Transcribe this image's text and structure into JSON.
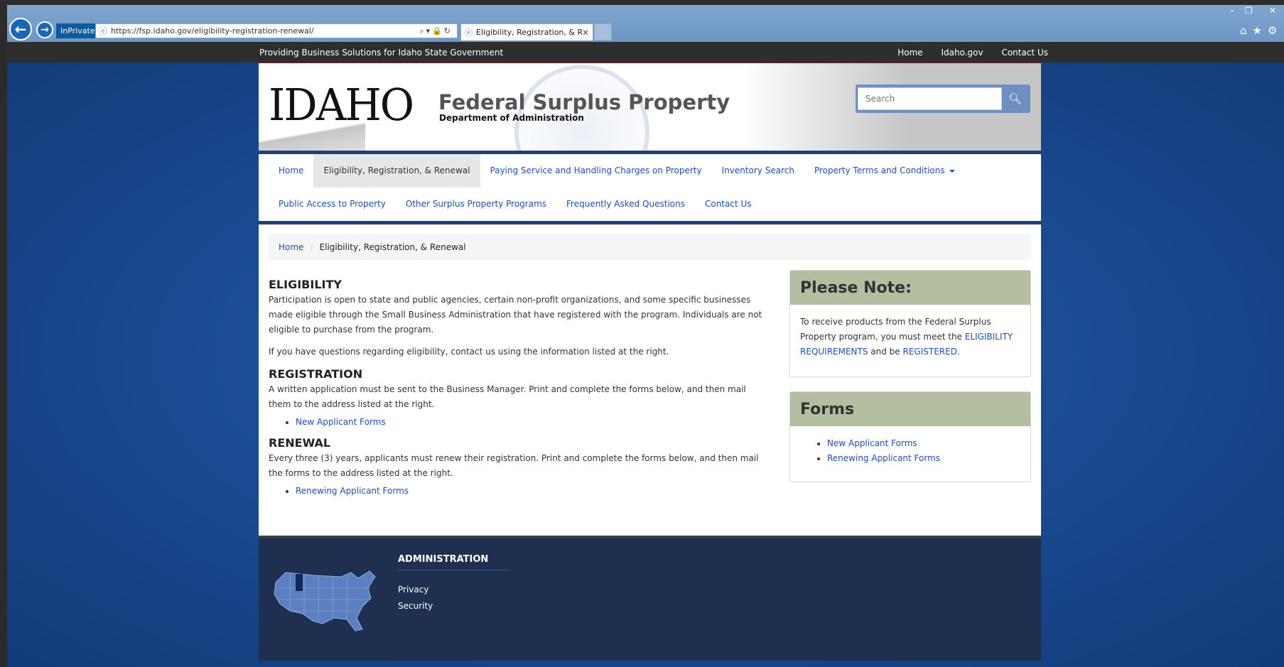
{
  "browser": {
    "mode_badge": "InPrivate",
    "url": "https://fsp.idaho.gov/eligibility-registration-renewal/",
    "tab_title": "Eligibility, Registration, & R...",
    "accent": "#1c67b3"
  },
  "topbar": {
    "tagline": "Providing Business Solutions for Idaho State Government",
    "links": [
      "Home",
      "Idaho.gov",
      "Contact Us"
    ]
  },
  "header": {
    "logo": "IDAHO",
    "title": "Federal Surplus Property",
    "subtitle": "Department of Administration",
    "search_placeholder": "Search"
  },
  "nav": {
    "row1": [
      "Home",
      "Eligibility, Registration, & Renewal",
      "Paying Service and Handling Charges on Property",
      "Inventory Search",
      "Property Terms and Conditions"
    ],
    "row2": [
      "Public Access to Property",
      "Other Surplus Property Programs",
      "Frequently Asked Questions",
      "Contact Us"
    ]
  },
  "breadcrumb": {
    "home": "Home",
    "current": "Eligibility, Registration, & Renewal"
  },
  "content": {
    "eligibility_heading": "ELIGIBILITY",
    "eligibility_p1": "Participation is open to state and public agencies, certain non-profit organizations, and some specific businesses made eligible through the Small Business Administration that have registered with the program. Individuals are not eligible to purchase from the program.",
    "eligibility_p2": "If you have questions regarding eligibility, contact us using the information listed at the right.",
    "registration_heading": "REGISTRATION",
    "registration_p": "A written application must be sent to the Business Manager. Print and complete the forms below, and then mail them to the address listed at the right.",
    "registration_link": "New Applicant Forms",
    "renewal_heading": "RENEWAL",
    "renewal_p": "Every three (3) years, applicants must renew their registration. Print and complete the forms below, and then mail the forms to the address listed at the right.",
    "renewal_link": "Renewing Applicant Forms"
  },
  "note_panel": {
    "heading": "Please Note:",
    "text_before": "To receive products from the Federal Surplus Property program, you must meet the ",
    "link1": "ELIGIBILITY REQUIREMENTS",
    "text_mid": " and be ",
    "link2": "REGISTERED",
    "text_end": "."
  },
  "forms_panel": {
    "heading": "Forms",
    "links": [
      "New Applicant Forms",
      "Renewing Applicant Forms"
    ]
  },
  "footer": {
    "heading": "ADMINISTRATION",
    "links": [
      "Privacy",
      "Security"
    ]
  },
  "colors": {
    "nav_border": "#1f3f77",
    "link": "#1f4fb0",
    "panel_heading": "#b4bea0",
    "footer_bg": "#1e2f4f"
  }
}
